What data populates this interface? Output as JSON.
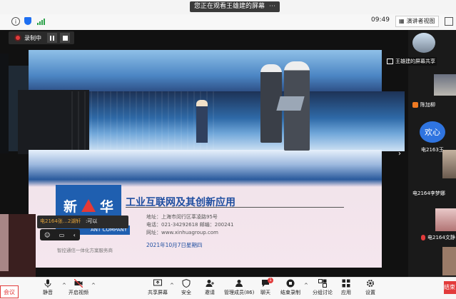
{
  "top": {
    "share_banner": "您正在观看王雄建的屏幕",
    "time": "09:49",
    "view_mode": "演讲者视图"
  },
  "recording": {
    "label": "录制中"
  },
  "slide": {
    "logo_char_1": "新",
    "logo_char_2": "华",
    "company_en": "ANT COMPANY",
    "title": "工业互联网及其创新应用",
    "company_line": "地址：上海市闵行区莘凌路95号",
    "phone_line": "电话：021-34292618      邮编：200241",
    "site_line": "网址：www.xinhuagroup.com",
    "date_line": "2021年10月7日星期四",
    "tagline": "智控通信一体化方案服务商"
  },
  "chat": {
    "name": "电2164张…2湖轩",
    "message": ":可以"
  },
  "participants": {
    "share_label": "王雄建的屏幕共享",
    "p2": "陈加柳",
    "p2_avatar": "欢心",
    "p3": "电2163王…",
    "p4": "电2164李梦娜",
    "p5": "电2164文静"
  },
  "toolbar": {
    "mute": "静音",
    "video": "开启视频",
    "share": "共享屏幕",
    "security": "安全",
    "invite": "邀请",
    "members": "管理成员(86)",
    "chat": "聊天",
    "end_record": "结束录制",
    "breakout": "分组讨论",
    "apps": "应用",
    "settings": "设置",
    "end_left": "会议",
    "end_right": "结束",
    "chat_badge": "1"
  },
  "colors": {
    "accent": "#2f74e0",
    "danger": "#e23b3b",
    "brand": "#1f5fb0"
  }
}
